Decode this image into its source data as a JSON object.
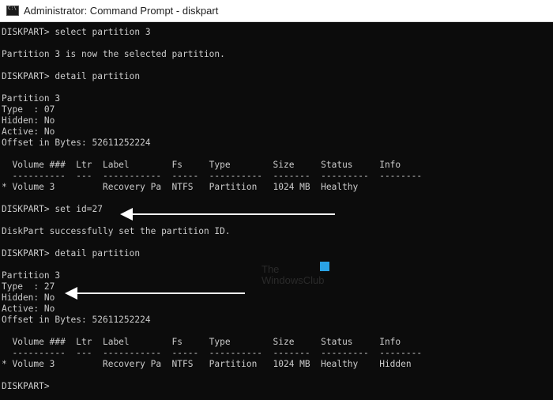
{
  "window": {
    "title": "Administrator: Command Prompt - diskpart",
    "icon": "cmd-icon"
  },
  "console": {
    "lines": [
      "DISKPART> select partition 3",
      "",
      "Partition 3 is now the selected partition.",
      "",
      "DISKPART> detail partition",
      "",
      "Partition 3",
      "Type  : 07",
      "Hidden: No",
      "Active: No",
      "Offset in Bytes: 52611252224",
      "",
      "  Volume ###  Ltr  Label        Fs     Type        Size     Status     Info",
      "  ----------  ---  -----------  -----  ----------  -------  ---------  --------",
      "* Volume 3         Recovery Pa  NTFS   Partition   1024 MB  Healthy",
      "",
      "DISKPART> set id=27",
      "",
      "DiskPart successfully set the partition ID.",
      "",
      "DISKPART> detail partition",
      "",
      "Partition 3",
      "Type  : 27",
      "Hidden: No",
      "Active: No",
      "Offset in Bytes: 52611252224",
      "",
      "  Volume ###  Ltr  Label        Fs     Type        Size     Status     Info",
      "  ----------  ---  -----------  -----  ----------  -------  ---------  --------",
      "* Volume 3         Recovery Pa  NTFS   Partition   1024 MB  Healthy    Hidden",
      "",
      "DISKPART> "
    ]
  },
  "annotations": {
    "arrows": [
      "set-id-arrow",
      "type-27-arrow"
    ]
  },
  "watermark": {
    "line1": "The",
    "line2": "WindowsClub"
  }
}
